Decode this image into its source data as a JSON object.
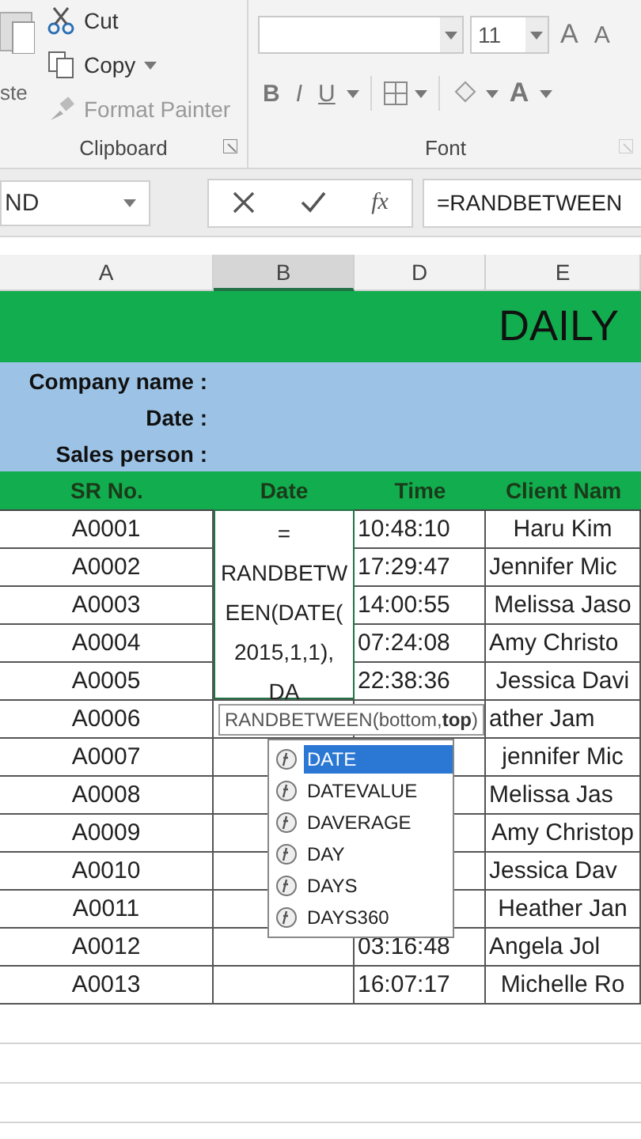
{
  "ribbon": {
    "clipboard": {
      "paste_label": "ste",
      "cut": "Cut",
      "copy": "Copy",
      "format_painter": "Format Painter",
      "format_painter_disabled": true,
      "label": "Clipboard"
    },
    "font": {
      "size": "11",
      "grow": "A",
      "shrink": "A",
      "bold": "B",
      "italic": "I",
      "underline": "U",
      "font_color": "A",
      "label": "Font"
    }
  },
  "formula_bar": {
    "name_box": "ND",
    "fx": "fx",
    "formula": "=RANDBETWEEN"
  },
  "columns": [
    {
      "label": "A",
      "selected": false
    },
    {
      "label": "B",
      "selected": true
    },
    {
      "label": "D",
      "selected": false
    },
    {
      "label": "E",
      "selected": false
    }
  ],
  "title": "DAILY",
  "info_labels": [
    "Company name :",
    "Date :",
    "Sales person :"
  ],
  "headers": [
    "SR No.",
    "Date",
    "Time",
    "Client Nam"
  ],
  "rows": [
    {
      "sr": "A0001",
      "time": "10:48:10",
      "client": "Haru Kim"
    },
    {
      "sr": "A0002",
      "time": "17:29:47",
      "client": "Jennifer Mic"
    },
    {
      "sr": "A0003",
      "time": "14:00:55",
      "client": "Melissa Jaso"
    },
    {
      "sr": "A0004",
      "time": "07:24:08",
      "client": "Amy Christo"
    },
    {
      "sr": "A0005",
      "time": "22:38:36",
      "client": "Jessica Davi"
    },
    {
      "sr": "A0006",
      "time": "",
      "client": "ather Jam"
    },
    {
      "sr": "A0007",
      "time": "",
      "client": "jennifer Mic"
    },
    {
      "sr": "A0008",
      "time": "",
      "client": "Melissa Jas"
    },
    {
      "sr": "A0009",
      "time": "",
      "client": "Amy Christop"
    },
    {
      "sr": "A0010",
      "time": "",
      "client": "Jessica Dav"
    },
    {
      "sr": "A0011",
      "time": "",
      "client": "Heather Jan"
    },
    {
      "sr": "A0012",
      "time": "03:16:48",
      "client": "Angela Jol"
    },
    {
      "sr": "A0013",
      "time": "16:07:17",
      "client": "Michelle Ro"
    }
  ],
  "editor_lines": [
    "=",
    "RANDBETW",
    "EEN(DATE(",
    "2015,1,1),",
    "DA"
  ],
  "tooltip": {
    "function": "RANDBETWEEN(bottom, ",
    "current_arg": "top",
    "close": ")"
  },
  "suggestions": [
    {
      "label": "DATE",
      "selected": true
    },
    {
      "label": "DATEVALUE",
      "selected": false
    },
    {
      "label": "DAVERAGE",
      "selected": false
    },
    {
      "label": "DAY",
      "selected": false
    },
    {
      "label": "DAYS",
      "selected": false
    },
    {
      "label": "DAYS360",
      "selected": false
    }
  ]
}
